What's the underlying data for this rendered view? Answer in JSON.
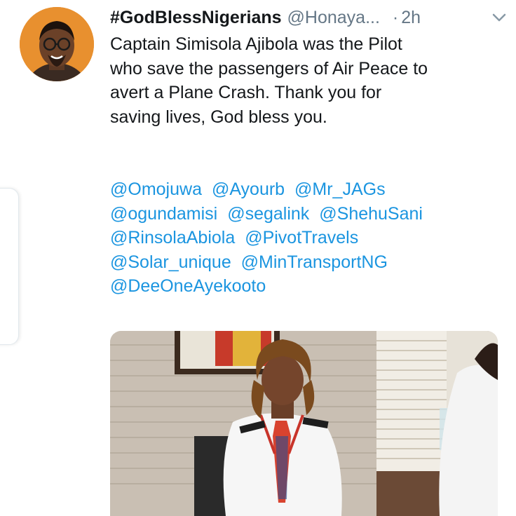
{
  "tweet": {
    "display_name": "#GodBlessNigerians",
    "handle": "@Honaya...",
    "separator": "·",
    "time": "2h",
    "text_lines": [
      "Captain Simisola Ajibola was the Pilot",
      "who save the passengers of Air Peace to",
      "avert a Plane Crash. Thank you for",
      "saving lives, God bless you."
    ],
    "mention_lines": [
      [
        "@Omojuwa",
        "@Ayourb",
        "@Mr_JAGs"
      ],
      [
        "@ogundamisi",
        "@segalink",
        "@ShehuSani"
      ],
      [
        "@RinsolaAbiola",
        "@PivotTravels"
      ],
      [
        "@Solar_unique",
        "@MinTransportNG"
      ],
      [
        "@DeeOneAyekooto"
      ]
    ]
  },
  "icons": {
    "menu": "chevron-down-icon",
    "avatar": "user-avatar",
    "media": "tweet-photo"
  },
  "colors": {
    "mention": "#1b95e0",
    "secondary_text": "#657786",
    "primary_text": "#14171a"
  }
}
